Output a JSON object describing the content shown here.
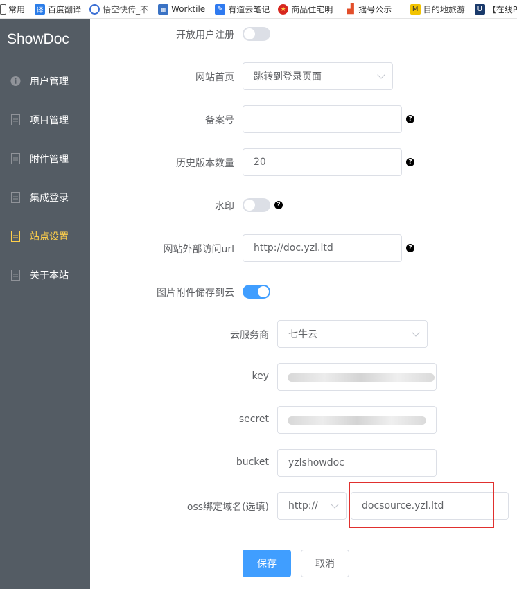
{
  "bookmarks": [
    {
      "label": "常用",
      "icon": "folder-icon",
      "color": "#ffffff"
    },
    {
      "label": "百度翻译",
      "icon": "translate-icon",
      "color": "#2b7de9"
    },
    {
      "label": "悟空快传_不",
      "icon": "wukong-icon",
      "color": "#3b6fd4"
    },
    {
      "label": "Worktile",
      "icon": "worktile-icon",
      "color": "#3a72c4"
    },
    {
      "label": "有道云笔记",
      "icon": "youdao-icon",
      "color": "#2f7af0"
    },
    {
      "label": "商品住宅明",
      "icon": "emblem-icon",
      "color": "#d7261e"
    },
    {
      "label": "摇号公示 --",
      "icon": "chart-icon",
      "color": "#e24e2a"
    },
    {
      "label": "目的地旅游",
      "icon": "mail-icon",
      "color": "#f2c300"
    },
    {
      "label": "【在线P",
      "icon": "app-icon",
      "color": "#1a3a6b"
    }
  ],
  "sidebar": {
    "brand": "ShowDoc",
    "items": [
      {
        "label": "用户管理",
        "icon": "info-icon",
        "active": false
      },
      {
        "label": "项目管理",
        "icon": "document-icon",
        "active": false
      },
      {
        "label": "附件管理",
        "icon": "document-icon",
        "active": false
      },
      {
        "label": "集成登录",
        "icon": "document-icon",
        "active": false
      },
      {
        "label": "站点设置",
        "icon": "document-icon",
        "active": true
      },
      {
        "label": "关于本站",
        "icon": "document-icon",
        "active": false
      }
    ]
  },
  "form": {
    "register_label": "开放用户注册",
    "register_enabled": false,
    "home_label": "网站首页",
    "home_value": "跳转到登录页面",
    "beian_label": "备案号",
    "beian_value": "",
    "history_label": "历史版本数量",
    "history_value": "20",
    "watermark_label": "水印",
    "watermark_enabled": false,
    "url_label": "网站外部访问url",
    "url_value": "http://doc.yzl.ltd",
    "cloud_label": "图片附件储存到云",
    "cloud_enabled": true,
    "provider_label": "云服务商",
    "provider_value": "七牛云",
    "key_label": "key",
    "secret_label": "secret",
    "bucket_label": "bucket",
    "bucket_value": "yzlshowdoc",
    "domain_label": "oss绑定域名(选填)",
    "protocol_value": "http://",
    "domain_value": "docsource.yzl.ltd",
    "help_symbol": "?"
  },
  "buttons": {
    "save": "保存",
    "cancel": "取消"
  },
  "colors": {
    "sidebar_bg": "#545c64",
    "active_nav": "#ffd04b",
    "primary": "#409eff",
    "highlight_box": "#e0302e"
  }
}
